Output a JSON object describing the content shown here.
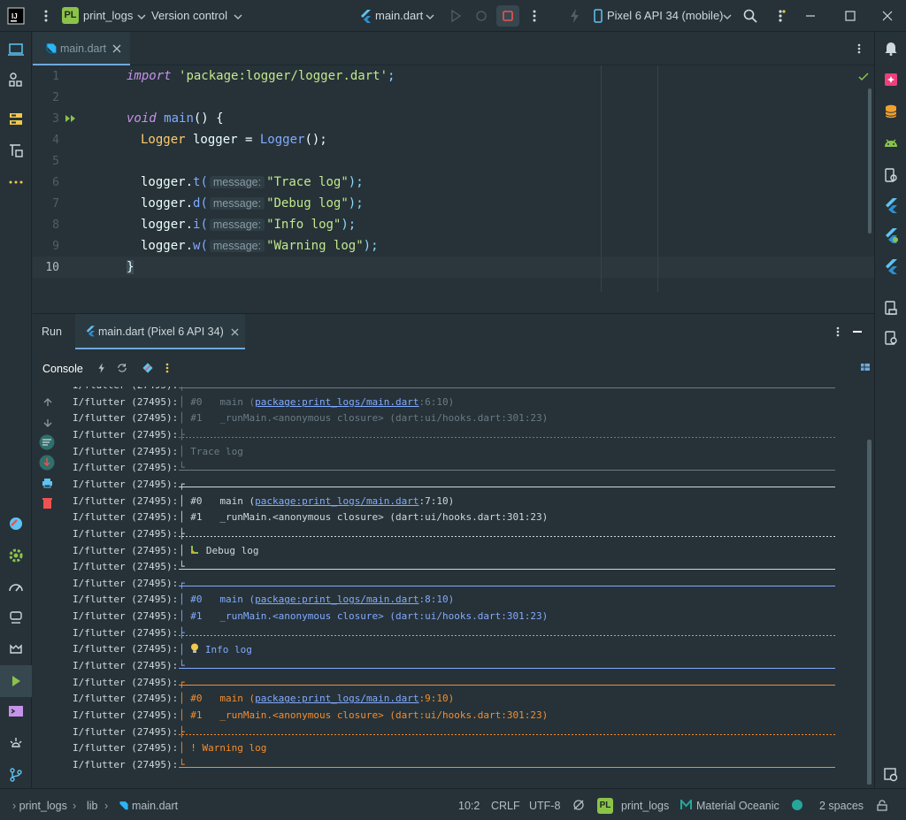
{
  "titlebar": {
    "project_badge": "PL",
    "project_name": "print_logs",
    "vcs": "Version control",
    "run_config": "main.dart",
    "device": "Pixel 6 API 34 (mobile)"
  },
  "editor": {
    "tab_label": "main.dart",
    "lines": [
      {
        "num": "1"
      },
      {
        "num": "2"
      },
      {
        "num": "3"
      },
      {
        "num": "4"
      },
      {
        "num": "5"
      },
      {
        "num": "6"
      },
      {
        "num": "7"
      },
      {
        "num": "8"
      },
      {
        "num": "9"
      },
      {
        "num": "10"
      }
    ],
    "code": {
      "l1_kw": "import",
      "l1_str": "'package:logger/logger.dart'",
      "l1_end": ";",
      "l3_kw": "void",
      "l3_fn": "main",
      "l3_rest": "() {",
      "l4_type": "Logger",
      "l4_var": " logger = ",
      "l4_ctor": "Logger",
      "l4_end": "();",
      "obj": "logger.",
      "hint": "message:",
      "m6": "t(",
      "s6": "\"Trace log\"",
      "m7": "d(",
      "s7": "\"Debug log\"",
      "m8": "i(",
      "s8": "\"Info log\"",
      "m9": "w(",
      "s9": "\"Warning log\"",
      "end": ");",
      "l10": "}"
    }
  },
  "run": {
    "title": "Run",
    "tab_label": "main.dart (Pixel 6 API 34)",
    "console_label": "Console"
  },
  "console": {
    "prefix": "I/flutter (27495):",
    "blocks": [
      {
        "kind": "trace",
        "frame0": "#0   main (",
        "link": "package:print_logs/main.dart",
        "loc0": ":6:10)",
        "frame1": "#1   _runMain.<anonymous closure> (dart:ui/hooks.dart:301:23)",
        "msg": "Trace log",
        "color": "#6b7b84"
      },
      {
        "kind": "debug",
        "frame0": "#0   main (",
        "link": "package:print_logs/main.dart",
        "loc0": ":7:10)",
        "frame1": "#1   _runMain.<anonymous closure> (dart:ui/hooks.dart:301:23)",
        "msg": "Debug log",
        "color": "#cfd8dc"
      },
      {
        "kind": "info",
        "frame0": "#0   main (",
        "link": "package:print_logs/main.dart",
        "loc0": ":8:10)",
        "frame1": "#1   _runMain.<anonymous closure> (dart:ui/hooks.dart:301:23)",
        "msg": "Info log",
        "color": "#82aaff"
      },
      {
        "kind": "warning",
        "frame0": "#0   main (",
        "link": "package:print_logs/main.dart",
        "loc0": ":9:10)",
        "frame1": "#1   _runMain.<anonymous closure> (dart:ui/hooks.dart:301:23)",
        "msg": "! Warning log",
        "color": "#f78c2d"
      }
    ]
  },
  "statusbar": {
    "crumb_project": "print_logs",
    "crumb_dir": "lib",
    "crumb_file": "main.dart",
    "position": "10:2",
    "line_sep": "CRLF",
    "encoding": "UTF-8",
    "badge": "PL",
    "project": "print_logs",
    "theme": "Material Oceanic",
    "indent": "2 spaces"
  },
  "colors": {
    "accent": "#6fa8dc",
    "warning": "#f78c2d",
    "info": "#82aaff",
    "link": "#82aaff",
    "badge_bg": "#8bc34a"
  }
}
